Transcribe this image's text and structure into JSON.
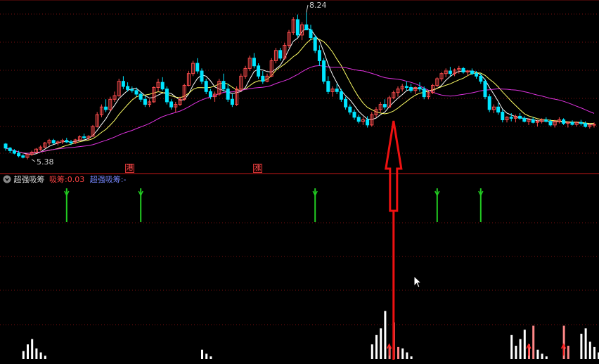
{
  "colors": {
    "background": "#000000",
    "up": "#ff4d4d",
    "down": "#00e5ff",
    "ma_short": "#ffffff",
    "ma_mid": "#ffff66",
    "ma_long": "#e033e0",
    "grid": "#7a1010",
    "signal_arrow": "#22cc22",
    "big_arrow": "#ee1111",
    "histogram": "#ffffff",
    "histogram_highlight": "#ff8888"
  },
  "price_panel": {
    "high_label": "8.24",
    "low_label": "5.38",
    "badges": [
      "港",
      "涨"
    ]
  },
  "indicator_panel": {
    "toggle_icon": "collapse-circle-icon",
    "name": "超强吸筹",
    "value_label_1": "吸筹:",
    "value_1": "0.03",
    "value_label_2": "超强吸筹:",
    "value_2": "-"
  },
  "chart_data": [
    {
      "type": "candlestick",
      "title": "",
      "ylim": [
        5.2,
        8.4
      ],
      "annotations": [
        {
          "text": "8.24",
          "x": 69
        },
        {
          "text": "5.38",
          "x": 6
        }
      ],
      "series_ma": [
        "ma_short",
        "ma_mid",
        "ma_long"
      ],
      "ohlc": [
        [
          5.68,
          5.7,
          5.55,
          5.6
        ],
        [
          5.6,
          5.62,
          5.5,
          5.55
        ],
        [
          5.55,
          5.58,
          5.48,
          5.5
        ],
        [
          5.5,
          5.55,
          5.42,
          5.45
        ],
        [
          5.45,
          5.48,
          5.4,
          5.42
        ],
        [
          5.42,
          5.5,
          5.38,
          5.48
        ],
        [
          5.48,
          5.55,
          5.45,
          5.52
        ],
        [
          5.52,
          5.6,
          5.5,
          5.58
        ],
        [
          5.58,
          5.65,
          5.55,
          5.62
        ],
        [
          5.62,
          5.72,
          5.6,
          5.7
        ],
        [
          5.7,
          5.78,
          5.65,
          5.75
        ],
        [
          5.75,
          5.78,
          5.68,
          5.7
        ],
        [
          5.7,
          5.75,
          5.65,
          5.72
        ],
        [
          5.72,
          5.78,
          5.68,
          5.75
        ],
        [
          5.75,
          5.8,
          5.7,
          5.72
        ],
        [
          5.72,
          5.76,
          5.66,
          5.7
        ],
        [
          5.7,
          5.78,
          5.68,
          5.76
        ],
        [
          5.76,
          5.85,
          5.74,
          5.82
        ],
        [
          5.82,
          5.88,
          5.78,
          5.8
        ],
        [
          5.8,
          5.85,
          5.76,
          5.83
        ],
        [
          5.83,
          6.05,
          5.82,
          6.02
        ],
        [
          6.02,
          6.3,
          6.0,
          6.25
        ],
        [
          6.25,
          6.45,
          6.2,
          6.4
        ],
        [
          6.4,
          6.55,
          6.3,
          6.35
        ],
        [
          6.35,
          6.6,
          6.32,
          6.55
        ],
        [
          6.55,
          6.7,
          6.5,
          6.62
        ],
        [
          6.62,
          6.95,
          6.6,
          6.9
        ],
        [
          6.9,
          7.0,
          6.75,
          6.8
        ],
        [
          6.8,
          6.88,
          6.7,
          6.74
        ],
        [
          6.74,
          6.8,
          6.68,
          6.72
        ],
        [
          6.72,
          6.78,
          6.6,
          6.65
        ],
        [
          6.65,
          6.7,
          6.5,
          6.55
        ],
        [
          6.55,
          6.62,
          6.4,
          6.45
        ],
        [
          6.45,
          6.55,
          6.4,
          6.5
        ],
        [
          6.5,
          6.8,
          6.48,
          6.78
        ],
        [
          6.78,
          6.95,
          6.7,
          6.88
        ],
        [
          6.88,
          6.98,
          6.72,
          6.75
        ],
        [
          6.75,
          6.8,
          6.45,
          6.5
        ],
        [
          6.5,
          6.55,
          6.35,
          6.4
        ],
        [
          6.4,
          6.5,
          6.3,
          6.45
        ],
        [
          6.45,
          6.6,
          6.42,
          6.55
        ],
        [
          6.55,
          6.85,
          6.52,
          6.82
        ],
        [
          6.82,
          7.1,
          6.8,
          7.05
        ],
        [
          7.05,
          7.3,
          7.0,
          7.25
        ],
        [
          7.25,
          7.35,
          7.05,
          7.1
        ],
        [
          7.1,
          7.15,
          6.85,
          6.9
        ],
        [
          6.9,
          6.95,
          6.65,
          6.7
        ],
        [
          6.7,
          6.75,
          6.55,
          6.6
        ],
        [
          6.6,
          6.7,
          6.5,
          6.65
        ],
        [
          6.65,
          6.95,
          6.62,
          6.9
        ],
        [
          6.9,
          7.05,
          6.7,
          6.75
        ],
        [
          6.75,
          6.85,
          6.5,
          6.55
        ],
        [
          6.55,
          6.65,
          6.4,
          6.45
        ],
        [
          6.45,
          6.8,
          6.42,
          6.75
        ],
        [
          6.75,
          7.05,
          6.7,
          7.0
        ],
        [
          7.0,
          7.2,
          6.95,
          7.15
        ],
        [
          7.15,
          7.4,
          7.1,
          7.35
        ],
        [
          7.35,
          7.45,
          7.15,
          7.2
        ],
        [
          7.2,
          7.25,
          6.95,
          7.0
        ],
        [
          7.0,
          7.1,
          6.85,
          6.9
        ],
        [
          6.9,
          7.05,
          6.88,
          7.0
        ],
        [
          7.0,
          7.35,
          6.98,
          7.3
        ],
        [
          7.3,
          7.55,
          7.25,
          7.5
        ],
        [
          7.5,
          7.55,
          7.3,
          7.35
        ],
        [
          7.35,
          7.65,
          7.32,
          7.6
        ],
        [
          7.6,
          7.9,
          7.55,
          7.85
        ],
        [
          7.85,
          8.15,
          7.8,
          8.1
        ],
        [
          8.1,
          8.2,
          7.75,
          7.8
        ],
        [
          7.8,
          8.05,
          7.7,
          8.0
        ],
        [
          8.0,
          8.24,
          7.95,
          7.9
        ],
        [
          7.9,
          8.0,
          7.7,
          7.75
        ],
        [
          7.75,
          7.8,
          7.45,
          7.5
        ],
        [
          7.5,
          7.6,
          7.2,
          7.3
        ],
        [
          7.3,
          7.35,
          6.85,
          6.9
        ],
        [
          6.9,
          7.0,
          6.65,
          6.7
        ],
        [
          6.7,
          6.8,
          6.6,
          6.75
        ],
        [
          6.75,
          6.85,
          6.65,
          6.7
        ],
        [
          6.7,
          6.75,
          6.5,
          6.55
        ],
        [
          6.55,
          6.6,
          6.35,
          6.4
        ],
        [
          6.4,
          6.45,
          6.25,
          6.3
        ],
        [
          6.3,
          6.35,
          6.15,
          6.2
        ],
        [
          6.2,
          6.25,
          6.08,
          6.12
        ],
        [
          6.12,
          6.2,
          6.05,
          6.15
        ],
        [
          6.15,
          6.22,
          6.0,
          6.05
        ],
        [
          6.05,
          6.3,
          6.02,
          6.25
        ],
        [
          6.25,
          6.4,
          6.2,
          6.35
        ],
        [
          6.35,
          6.5,
          6.3,
          6.45
        ],
        [
          6.45,
          6.55,
          6.35,
          6.4
        ],
        [
          6.4,
          6.62,
          6.38,
          6.58
        ],
        [
          6.58,
          6.72,
          6.55,
          6.68
        ],
        [
          6.68,
          6.8,
          6.6,
          6.75
        ],
        [
          6.75,
          6.85,
          6.7,
          6.8
        ],
        [
          6.8,
          6.9,
          6.72,
          6.78
        ],
        [
          6.78,
          6.85,
          6.68,
          6.72
        ],
        [
          6.72,
          6.8,
          6.65,
          6.78
        ],
        [
          6.78,
          6.88,
          6.7,
          6.75
        ],
        [
          6.75,
          6.8,
          6.55,
          6.6
        ],
        [
          6.6,
          6.7,
          6.55,
          6.68
        ],
        [
          6.68,
          6.85,
          6.65,
          6.82
        ],
        [
          6.82,
          6.98,
          6.78,
          6.95
        ],
        [
          6.95,
          7.08,
          6.9,
          7.05
        ],
        [
          7.05,
          7.15,
          6.98,
          7.1
        ],
        [
          7.1,
          7.18,
          7.0,
          7.05
        ],
        [
          7.05,
          7.15,
          7.0,
          7.12
        ],
        [
          7.12,
          7.2,
          7.05,
          7.15
        ],
        [
          7.15,
          7.18,
          7.05,
          7.08
        ],
        [
          7.08,
          7.12,
          7.0,
          7.1
        ],
        [
          7.1,
          7.15,
          7.02,
          7.05
        ],
        [
          7.05,
          7.1,
          6.95,
          7.0
        ],
        [
          7.0,
          7.05,
          6.85,
          6.9
        ],
        [
          6.9,
          6.95,
          6.55,
          6.6
        ],
        [
          6.6,
          6.65,
          6.3,
          6.35
        ],
        [
          6.35,
          6.45,
          6.28,
          6.4
        ],
        [
          6.4,
          6.48,
          6.25,
          6.3
        ],
        [
          6.3,
          6.35,
          6.1,
          6.15
        ],
        [
          6.15,
          6.22,
          6.1,
          6.2
        ],
        [
          6.2,
          6.28,
          6.12,
          6.18
        ],
        [
          6.18,
          6.25,
          6.1,
          6.22
        ],
        [
          6.22,
          6.28,
          6.15,
          6.18
        ],
        [
          6.18,
          6.22,
          6.1,
          6.12
        ],
        [
          6.12,
          6.18,
          6.05,
          6.15
        ],
        [
          6.15,
          6.2,
          6.08,
          6.1
        ],
        [
          6.1,
          6.15,
          6.02,
          6.12
        ],
        [
          6.12,
          6.18,
          6.08,
          6.15
        ],
        [
          6.15,
          6.2,
          6.1,
          6.12
        ],
        [
          6.12,
          6.16,
          6.02,
          6.05
        ],
        [
          6.05,
          6.15,
          6.0,
          6.12
        ],
        [
          6.12,
          6.2,
          6.08,
          6.15
        ],
        [
          6.15,
          6.18,
          6.05,
          6.08
        ],
        [
          6.08,
          6.12,
          6.0,
          6.1
        ],
        [
          6.1,
          6.14,
          6.04,
          6.06
        ],
        [
          6.06,
          6.12,
          6.02,
          6.1
        ],
        [
          6.1,
          6.15,
          6.04,
          6.08
        ],
        [
          6.08,
          6.12,
          6.0,
          6.02
        ],
        [
          6.02,
          6.08,
          5.98,
          6.05
        ],
        [
          6.05,
          6.1,
          6.0,
          6.06
        ]
      ]
    },
    {
      "type": "indicator",
      "name": "超强吸筹",
      "signals": [
        14,
        31,
        71,
        99,
        109
      ],
      "big_arrow_at": 89,
      "histogram": [
        {
          "i": 4,
          "v": 0.12
        },
        {
          "i": 5,
          "v": 0.22
        },
        {
          "i": 6,
          "v": 0.3
        },
        {
          "i": 7,
          "v": 0.16
        },
        {
          "i": 8,
          "v": 0.1
        },
        {
          "i": 9,
          "v": 0.05
        },
        {
          "i": 45,
          "v": 0.14
        },
        {
          "i": 46,
          "v": 0.08
        },
        {
          "i": 47,
          "v": 0.04
        },
        {
          "i": 84,
          "v": 0.22
        },
        {
          "i": 85,
          "v": 0.36
        },
        {
          "i": 86,
          "v": 0.46
        },
        {
          "i": 87,
          "v": 0.72
        },
        {
          "i": 88,
          "v": 0.2,
          "h": true
        },
        {
          "i": 89,
          "v": 0.55,
          "h": true
        },
        {
          "i": 90,
          "v": 0.18,
          "h": true
        },
        {
          "i": 91,
          "v": 0.16
        },
        {
          "i": 92,
          "v": 0.1
        },
        {
          "i": 93,
          "v": 0.04
        },
        {
          "i": 116,
          "v": 0.36
        },
        {
          "i": 117,
          "v": 0.2
        },
        {
          "i": 118,
          "v": 0.3
        },
        {
          "i": 119,
          "v": 0.44
        },
        {
          "i": 120,
          "v": 0.22,
          "h": true
        },
        {
          "i": 121,
          "v": 0.5,
          "h": true
        },
        {
          "i": 122,
          "v": 0.14
        },
        {
          "i": 123,
          "v": 0.08
        },
        {
          "i": 124,
          "v": 0.04
        },
        {
          "i": 128,
          "v": 0.5,
          "h": true
        },
        {
          "i": 129,
          "v": 0.2,
          "h": true
        },
        {
          "i": 132,
          "v": 0.38
        },
        {
          "i": 133,
          "v": 0.46
        },
        {
          "i": 134,
          "v": 0.26
        },
        {
          "i": 135,
          "v": 0.18
        },
        {
          "i": 136,
          "v": 0.1
        },
        {
          "i": 137,
          "v": 0.06
        },
        {
          "i": 138,
          "v": 0.04
        }
      ]
    }
  ]
}
